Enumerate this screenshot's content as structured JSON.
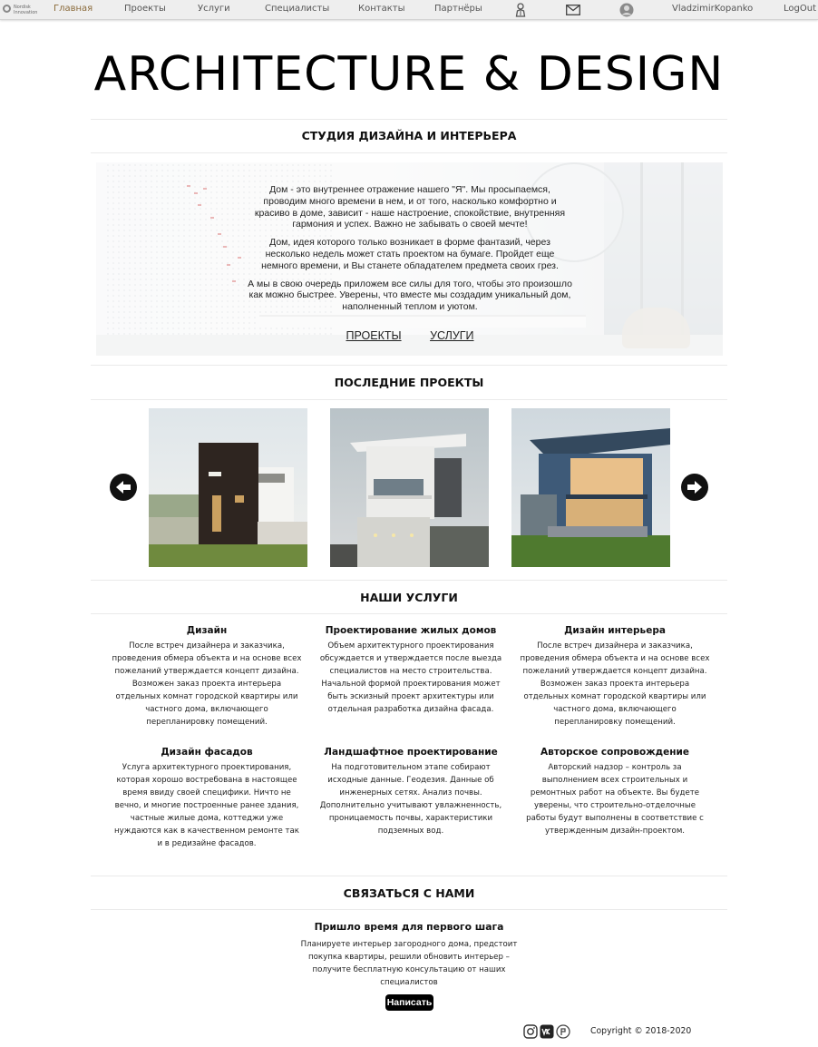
{
  "nav": {
    "logo_line1": "Nordisk",
    "logo_line2": "Innovation",
    "items": [
      "Главная",
      "Проекты",
      "Услуги",
      "Специалисты",
      "Контакты",
      "Партнёры"
    ],
    "username": "VladzimirKopanko",
    "logout": "LogOut",
    "active_color": "#8a6a3a"
  },
  "site_title": "ARCHITECTURE & DESIGN",
  "studio": {
    "heading": "СТУДИЯ ДИЗАЙНА И ИНТЕРЬЕРА",
    "paragraphs": [
      "Дом - это внутреннее отражение нашего \"Я\". Мы просыпаемся, проводим много времени в нем, и от того, насколько комфортно и красиво в доме, зависит - наше настроение, спокойствие, внутренняя гармония и успех. Важно не забывать о своей мечте!",
      "Дом, идея которого только возникает в форме фантазий, через несколько недель может стать проектом на бумаге. Пройдет еще немного времени, и Вы станете обладателем предмета своих грез.",
      "А мы в свою очередь приложем все силы для того, чтобы это произошло как можно быстрее. Уверены, что вместе мы создадим уникальный дом, наполненный теплом и уютом."
    ],
    "link_projects": "ПРОЕКТЫ",
    "link_services": "УСЛУГИ"
  },
  "projects": {
    "heading": "ПОСЛЕДНИЕ ПРОЕКТЫ",
    "prev_icon": "arrow-left-circle-icon",
    "next_icon": "arrow-right-circle-icon"
  },
  "services": {
    "heading": "НАШИ УСЛУГИ",
    "items": [
      {
        "title": "Дизайн",
        "text": "После встреч дизайнера и заказчика, проведения обмера объекта и на основе всех пожеланий утверждается концепт дизайна. Возможен заказ проекта интерьера отдельных комнат городской квартиры или частного дома, включающего перепланировку помещений."
      },
      {
        "title": "Проектирование жилых домов",
        "text": "Объем архитектурного проектирования обсуждается и утверждается после выезда специалистов на место строительства. Начальной формой проектирования может быть эскизный проект архитектуры или отдельная разработка дизайна фасада."
      },
      {
        "title": "Дизайн интерьера",
        "text": "После встреч дизайнера и заказчика, проведения обмера объекта и на основе всех пожеланий утверждается концепт дизайна. Возможен заказ проекта интерьера отдельных комнат городской квартиры или частного дома, включающего перепланировку помещений."
      },
      {
        "title": "Дизайн фасадов",
        "text": "Услуга архитектурного проектирования, которая хорошо востребована в настоящее время ввиду своей специфики. Ничто не вечно, и многие построенные ранее здания, частные жилые дома, коттеджи уже нуждаются как в качественном ремонте так и в редизайне фасадов."
      },
      {
        "title": "Ландшафтное проектирование",
        "text": "На подготовительном этапе собирают исходные данные. Геодезия. Данные об инженерных сетях. Анализ почвы. Дополнительно учитывают увлажненность, проницаемость почвы, характеристики подземных вод."
      },
      {
        "title": "Авторское сопровождение",
        "text": "Авторский надзор – контроль за выполнением всех строительных и ремонтных работ на объекте. Вы будете уверены, что строительно-отделочные работы будут выполнены в соответствие с утвержденным дизайн-проектом."
      }
    ]
  },
  "contact": {
    "heading": "СВЯЗАТЬСЯ С НАМИ",
    "title": "Пришло время для первого шага",
    "text": "Планируете интерьер загородного дома, предстоит покупка квартиры, решили обновить интерьер – получите бесплатную консультацию от наших специалистов",
    "button": "Написать"
  },
  "footer": {
    "social_icons": [
      "instagram-icon",
      "vk-icon",
      "social-icon"
    ],
    "copyright": "Copyright © 2018-2020"
  }
}
